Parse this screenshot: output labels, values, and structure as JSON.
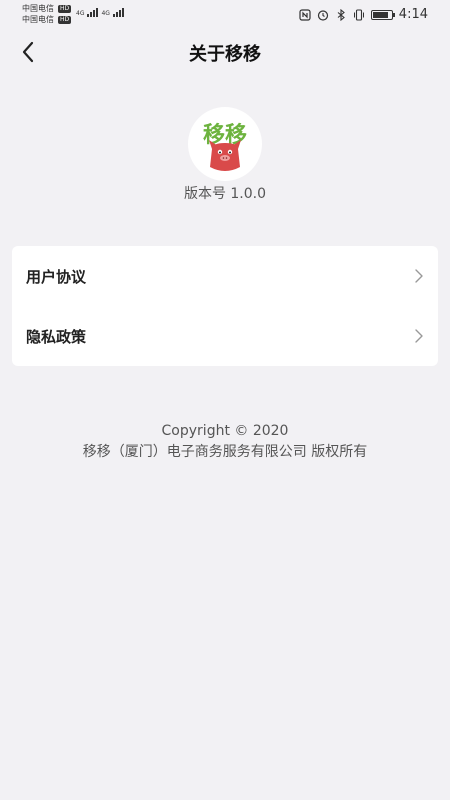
{
  "status_bar": {
    "carrier_1": "中国电信",
    "carrier_2": "中国电信",
    "hd_badge": "HD",
    "network_1": "4G",
    "network_2": "4G",
    "time": "4:14",
    "icons": [
      "nfc-icon",
      "alarm-icon",
      "bluetooth-icon",
      "vibrate-icon",
      "battery-icon"
    ],
    "battery_level": 0.85
  },
  "header": {
    "title": "关于移移",
    "back_icon": "chevron-left-icon"
  },
  "logo": {
    "text": "移移",
    "accent_color": "#6db33f",
    "mascot_color": "#d94a4a"
  },
  "version": "版本号 1.0.0",
  "menu": {
    "items": [
      {
        "label": "用户协议",
        "icon": "chevron-right-icon"
      },
      {
        "label": "隐私政策",
        "icon": "chevron-right-icon"
      }
    ]
  },
  "footer": {
    "copyright": "Copyright © 2020",
    "company": "移移（厦门）电子商务服务有限公司 版权所有"
  }
}
